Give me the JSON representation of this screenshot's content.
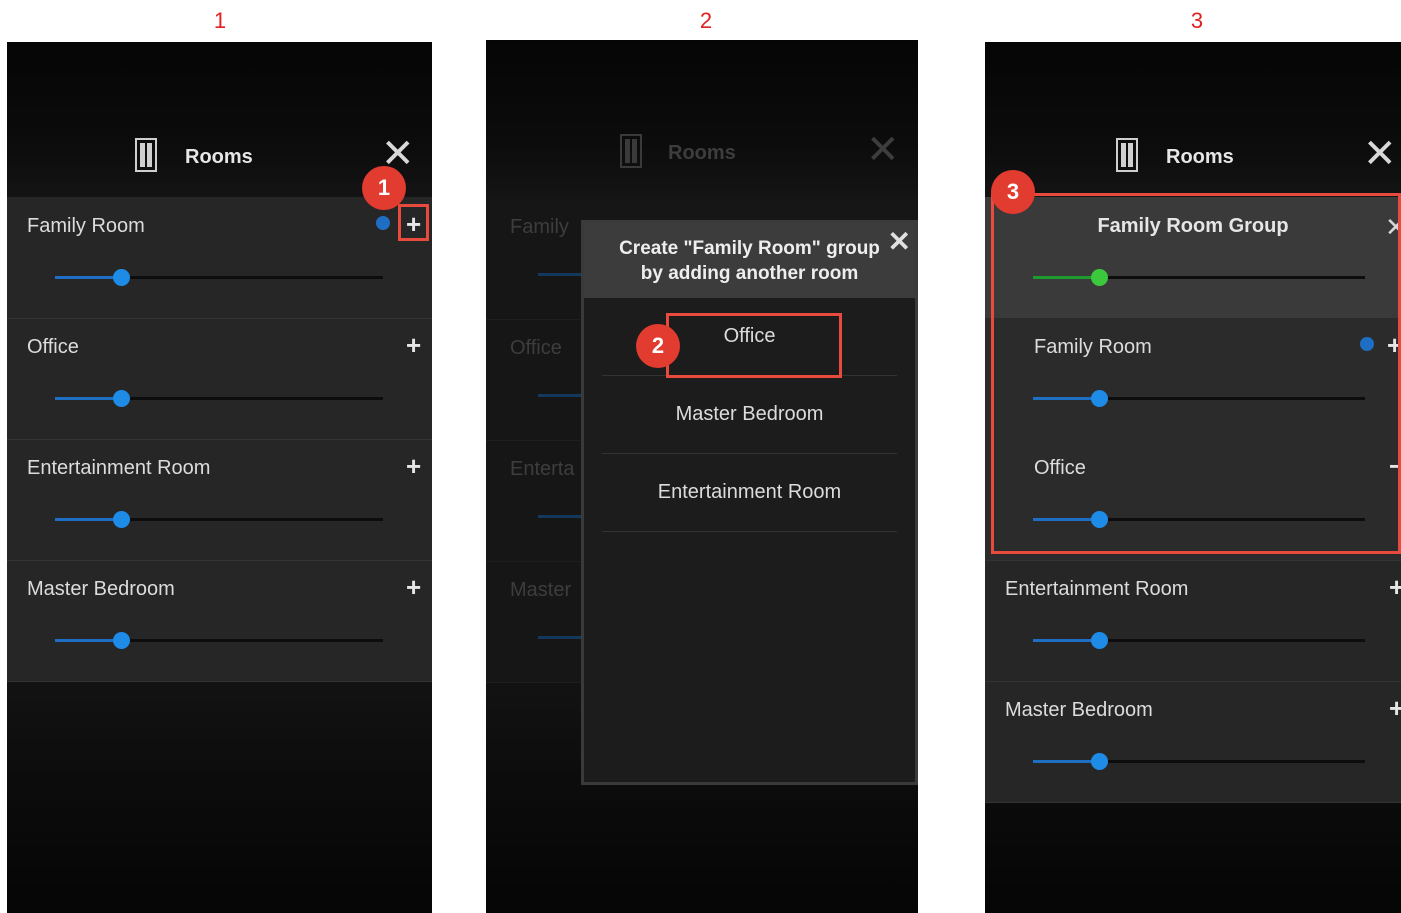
{
  "steps": [
    "1",
    "2",
    "3"
  ],
  "app": {
    "title": "Rooms",
    "icon": "speaker-icon",
    "close_icon": "✕",
    "plus_icon": "+",
    "minus_icon": "−"
  },
  "panel1": {
    "rooms": [
      {
        "name": "Family Room",
        "level": 0.2,
        "active": true
      },
      {
        "name": "Office",
        "level": 0.2
      },
      {
        "name": "Entertainment Room",
        "level": 0.2
      },
      {
        "name": "Master Bedroom",
        "level": 0.2
      }
    ],
    "badge": "1"
  },
  "panel2": {
    "bg_rooms": [
      "Family",
      "Office",
      "Enterta",
      "Master"
    ],
    "modal_title_line1": "Create \"Family Room\" group",
    "modal_title_line2": "by adding another room",
    "options": [
      "Office",
      "Master Bedroom",
      "Entertainment Room"
    ],
    "badge": "2"
  },
  "panel3": {
    "group_title": "Family Room Group",
    "group_level": 0.2,
    "group_members": [
      {
        "name": "Family Room",
        "level": 0.2,
        "active": true
      },
      {
        "name": "Office",
        "level": 0.2
      }
    ],
    "rooms": [
      {
        "name": "Entertainment Room",
        "level": 0.2
      },
      {
        "name": "Master Bedroom",
        "level": 0.2
      }
    ],
    "badge": "3"
  },
  "colors": {
    "accent_blue": "#1e8be6",
    "group_green": "#3cc83c",
    "highlight_red": "#e84b3e"
  }
}
